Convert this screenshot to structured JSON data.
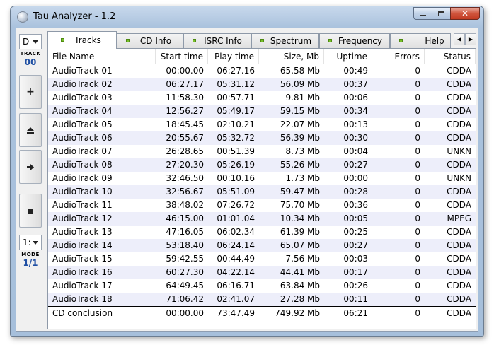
{
  "window": {
    "title": "Tau Analyzer - 1.2"
  },
  "toolbar": {
    "drive": "D",
    "track_label": "TRACK",
    "track_value": "00",
    "mode_select": "1:",
    "mode_label": "MODE",
    "mode_value": "1/1",
    "buttons": [
      "plus-icon",
      "eject-icon",
      "arrow-right-icon",
      "stop-icon"
    ]
  },
  "tabs": [
    {
      "label": "Tracks",
      "active": true
    },
    {
      "label": "CD Info",
      "active": false
    },
    {
      "label": "ISRC Info",
      "active": false
    },
    {
      "label": "Spectrum",
      "active": false
    },
    {
      "label": "Frequency",
      "active": false
    },
    {
      "label": "Help",
      "active": false
    }
  ],
  "table": {
    "columns": [
      "File Name",
      "Start time",
      "Play time",
      "Size, Mb",
      "Uptime",
      "Errors",
      "Status"
    ],
    "rows": [
      [
        "AudioTrack 01",
        "00:00.00",
        "06:27.16",
        "65.58 Mb",
        "00:49",
        "0",
        "CDDA"
      ],
      [
        "AudioTrack 02",
        "06:27.17",
        "05:31.12",
        "56.09 Mb",
        "00:37",
        "0",
        "CDDA"
      ],
      [
        "AudioTrack 03",
        "11:58.30",
        "00:57.71",
        "9.81 Mb",
        "00:06",
        "0",
        "CDDA"
      ],
      [
        "AudioTrack 04",
        "12:56.27",
        "05:49.17",
        "59.15 Mb",
        "00:34",
        "0",
        "CDDA"
      ],
      [
        "AudioTrack 05",
        "18:45.45",
        "02:10.21",
        "22.07 Mb",
        "00:13",
        "0",
        "CDDA"
      ],
      [
        "AudioTrack 06",
        "20:55.67",
        "05:32.72",
        "56.39 Mb",
        "00:30",
        "0",
        "CDDA"
      ],
      [
        "AudioTrack 07",
        "26:28.65",
        "00:51.39",
        "8.73 Mb",
        "00:04",
        "0",
        "UNKN"
      ],
      [
        "AudioTrack 08",
        "27:20.30",
        "05:26.19",
        "55.26 Mb",
        "00:27",
        "0",
        "CDDA"
      ],
      [
        "AudioTrack 09",
        "32:46.50",
        "00:10.16",
        "1.73 Mb",
        "00:00",
        "0",
        "UNKN"
      ],
      [
        "AudioTrack 10",
        "32:56.67",
        "05:51.09",
        "59.47 Mb",
        "00:28",
        "0",
        "CDDA"
      ],
      [
        "AudioTrack 11",
        "38:48.02",
        "07:26.72",
        "75.70 Mb",
        "00:36",
        "0",
        "CDDA"
      ],
      [
        "AudioTrack 12",
        "46:15.00",
        "01:01.04",
        "10.34 Mb",
        "00:05",
        "0",
        "MPEG"
      ],
      [
        "AudioTrack 13",
        "47:16.05",
        "06:02.34",
        "61.39 Mb",
        "00:25",
        "0",
        "CDDA"
      ],
      [
        "AudioTrack 14",
        "53:18.40",
        "06:24.14",
        "65.07 Mb",
        "00:27",
        "0",
        "CDDA"
      ],
      [
        "AudioTrack 15",
        "59:42.55",
        "00:44.49",
        "7.56 Mb",
        "00:03",
        "0",
        "CDDA"
      ],
      [
        "AudioTrack 16",
        "60:27.30",
        "04:22.14",
        "44.41 Mb",
        "00:17",
        "0",
        "CDDA"
      ],
      [
        "AudioTrack 17",
        "64:49.45",
        "06:16.71",
        "63.84 Mb",
        "00:26",
        "0",
        "CDDA"
      ],
      [
        "AudioTrack 18",
        "71:06.42",
        "02:41.07",
        "27.28 Mb",
        "00:11",
        "0",
        "CDDA"
      ]
    ],
    "summary": [
      "CD conclusion",
      "00:00.00",
      "73:47.49",
      "749.92 Mb",
      "06:21",
      "0",
      "CDDA"
    ]
  }
}
